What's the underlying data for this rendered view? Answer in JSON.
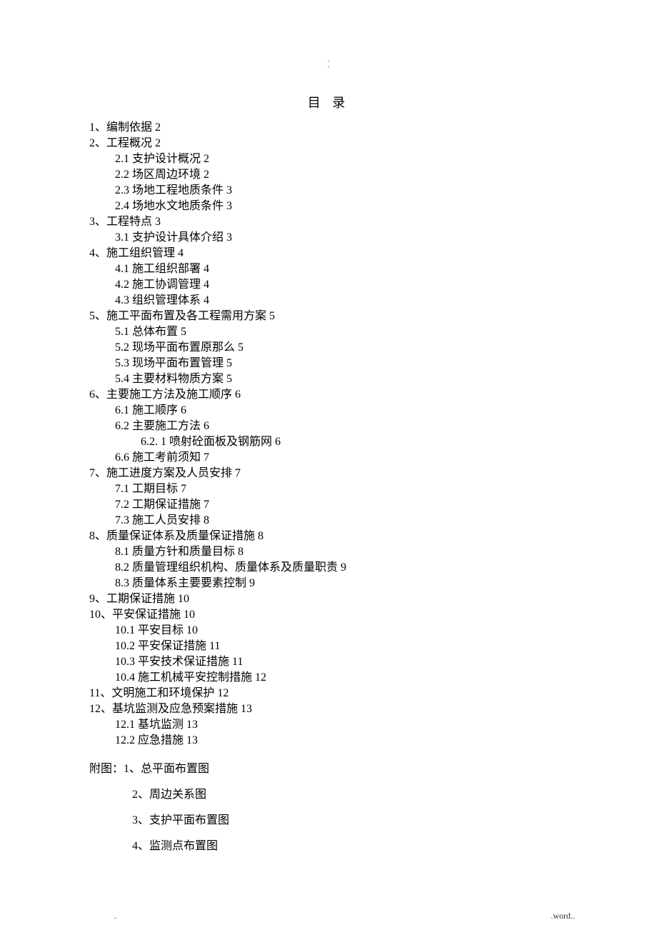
{
  "header_dot": ".",
  "title": "目 录",
  "toc": [
    {
      "level": 1,
      "text": "1、编制依据 2"
    },
    {
      "level": 1,
      "text": "2、工程概况 2"
    },
    {
      "level": 2,
      "text": "2.1 支护设计概况 2"
    },
    {
      "level": 2,
      "text": "2.2 场区周边环境 2"
    },
    {
      "level": 2,
      "text": "2.3 场地工程地质条件 3"
    },
    {
      "level": 2,
      "text": "2.4 场地水文地质条件 3"
    },
    {
      "level": 1,
      "text": "3、工程特点 3"
    },
    {
      "level": 2,
      "text": "3.1 支护设计具体介绍 3"
    },
    {
      "level": 1,
      "text": "4、施工组织管理 4"
    },
    {
      "level": 2,
      "text": "4.1 施工组织部署 4"
    },
    {
      "level": 2,
      "text": "4.2 施工协调管理 4"
    },
    {
      "level": 2,
      "text": "4.3 组织管理体系 4"
    },
    {
      "level": 1,
      "text": "5、施工平面布置及各工程需用方案 5"
    },
    {
      "level": 2,
      "text": "5.1 总体布置 5"
    },
    {
      "level": 2,
      "text": "5.2 现场平面布置原那么 5"
    },
    {
      "level": 2,
      "text": "5.3 现场平面布置管理 5"
    },
    {
      "level": 2,
      "text": "5.4 主要材料物质方案 5"
    },
    {
      "level": 1,
      "text": "6、主要施工方法及施工顺序 6"
    },
    {
      "level": 2,
      "text": "6.1 施工顺序 6"
    },
    {
      "level": 2,
      "text": "6.2 主要施工方法 6"
    },
    {
      "level": 3,
      "text": "6.2. 1 喷射砼面板及钢筋网 6"
    },
    {
      "level": 2,
      "text": "6.6 施工考前须知 7"
    },
    {
      "level": 1,
      "text": "7、施工进度方案及人员安排 7"
    },
    {
      "level": 2,
      "text": "7.1 工期目标 7"
    },
    {
      "level": 2,
      "text": "7.2 工期保证措施 7"
    },
    {
      "level": 2,
      "text": "7.3 施工人员安排 8"
    },
    {
      "level": 1,
      "text": "8、质量保证体系及质量保证措施 8"
    },
    {
      "level": 2,
      "text": "8.1 质量方针和质量目标 8"
    },
    {
      "level": 2,
      "text": "8.2 质量管理组织机构、质量体系及质量职责 9"
    },
    {
      "level": 2,
      "text": "8.3 质量体系主要要素控制 9"
    },
    {
      "level": 1,
      "text": "9、工期保证措施 10"
    },
    {
      "level": 1,
      "text": "10、平安保证措施 10"
    },
    {
      "level": 2,
      "text": "10.1 平安目标 10"
    },
    {
      "level": 2,
      "text": "10.2 平安保证措施 11"
    },
    {
      "level": 2,
      "text": "10.3 平安技术保证措施 11"
    },
    {
      "level": 2,
      "text": "10.4 施工机械平安控制措施 12"
    },
    {
      "level": 1,
      "text": "11、文明施工和环境保护 12"
    },
    {
      "level": 1,
      "text": "12、基坑监测及应急预案措施 13"
    },
    {
      "level": 2,
      "text": "12.1 基坑监测 13"
    },
    {
      "level": 2,
      "text": "12.2 应急措施 13"
    }
  ],
  "appendix_lead": "附图：1、总平面布置图",
  "appendix_items": [
    "2、周边关系图",
    "3、支护平面布置图",
    "4、监测点布置图"
  ],
  "footer_left": ".",
  "footer_right": ".word.."
}
